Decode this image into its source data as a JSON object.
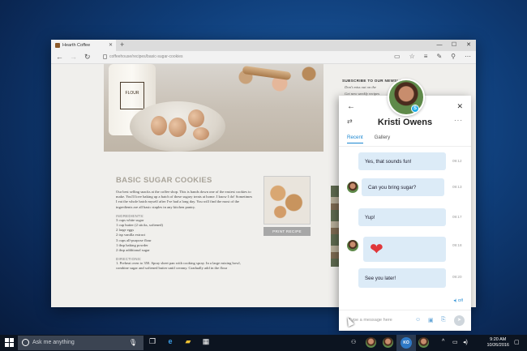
{
  "browser": {
    "tab_title": "Hearth Coffee",
    "url": "coffeehouse/recipes/basic-sugar-cookies",
    "window_controls": [
      "—",
      "☐",
      "✕"
    ]
  },
  "page": {
    "flour_label": "FLOUR",
    "subscribe_title": "SUBSCRIBE TO OUR NEWSLETTER",
    "subscribe_line1": "Don't miss out on the",
    "subscribe_line2": "Get new weekly recipes",
    "recipe_title": "BASIC SUGAR COOKIES",
    "intro": "Our best selling snacks at the coffee shop. This is hands down one of the easiest cookies to make. You'll love baking up a batch of these sugary treats at home. I know I do! Sometimes I eat the whole batch myself after I've had a long day. You will find the most of the ingredients are all basic staples in any kitchen pantry.",
    "ingredients_label": "INGREDIENTS:",
    "ingredients": [
      "3 cups white sugar",
      "1 cup butter (2 sticks, softened)",
      "2 large eggs",
      "2 tsp vanilla extract",
      "3 cups all-purpose flour",
      "1 tbsp baking powder",
      "2 tbsp additional sugar"
    ],
    "directions_label": "DIRECTIONS:",
    "directions": "1. Preheat oven to 350. Spray sheet pan with cooking spray. In a large mixing bowl, combine sugar and softened butter until creamy. Gradually add in the flour",
    "print_label": "PRINT RECIPE"
  },
  "skype": {
    "contact_name": "Kristi Owens",
    "tabs": [
      {
        "label": "Recent",
        "active": true
      },
      {
        "label": "Gallery",
        "active": false
      }
    ],
    "messages": [
      {
        "text": "Yes, that sounds fun!",
        "time": "09:12",
        "from": "me"
      },
      {
        "text": "Can you bring sugar?",
        "time": "09:13",
        "from": "them"
      },
      {
        "text": "Yup!",
        "time": "09:17",
        "from": "me"
      },
      {
        "text": "❤",
        "time": "09:18",
        "from": "them",
        "heart": true
      },
      {
        "text": "See you later!",
        "time": "09:20",
        "from": "me"
      }
    ],
    "status": "Off",
    "input_placeholder": "Type a message here",
    "accent": "#1a86d0",
    "bubble_color": "#dcebf7"
  },
  "taskbar": {
    "search_placeholder": "Ask me anything",
    "time": "9:20 AM",
    "date": "10/26/2016"
  }
}
